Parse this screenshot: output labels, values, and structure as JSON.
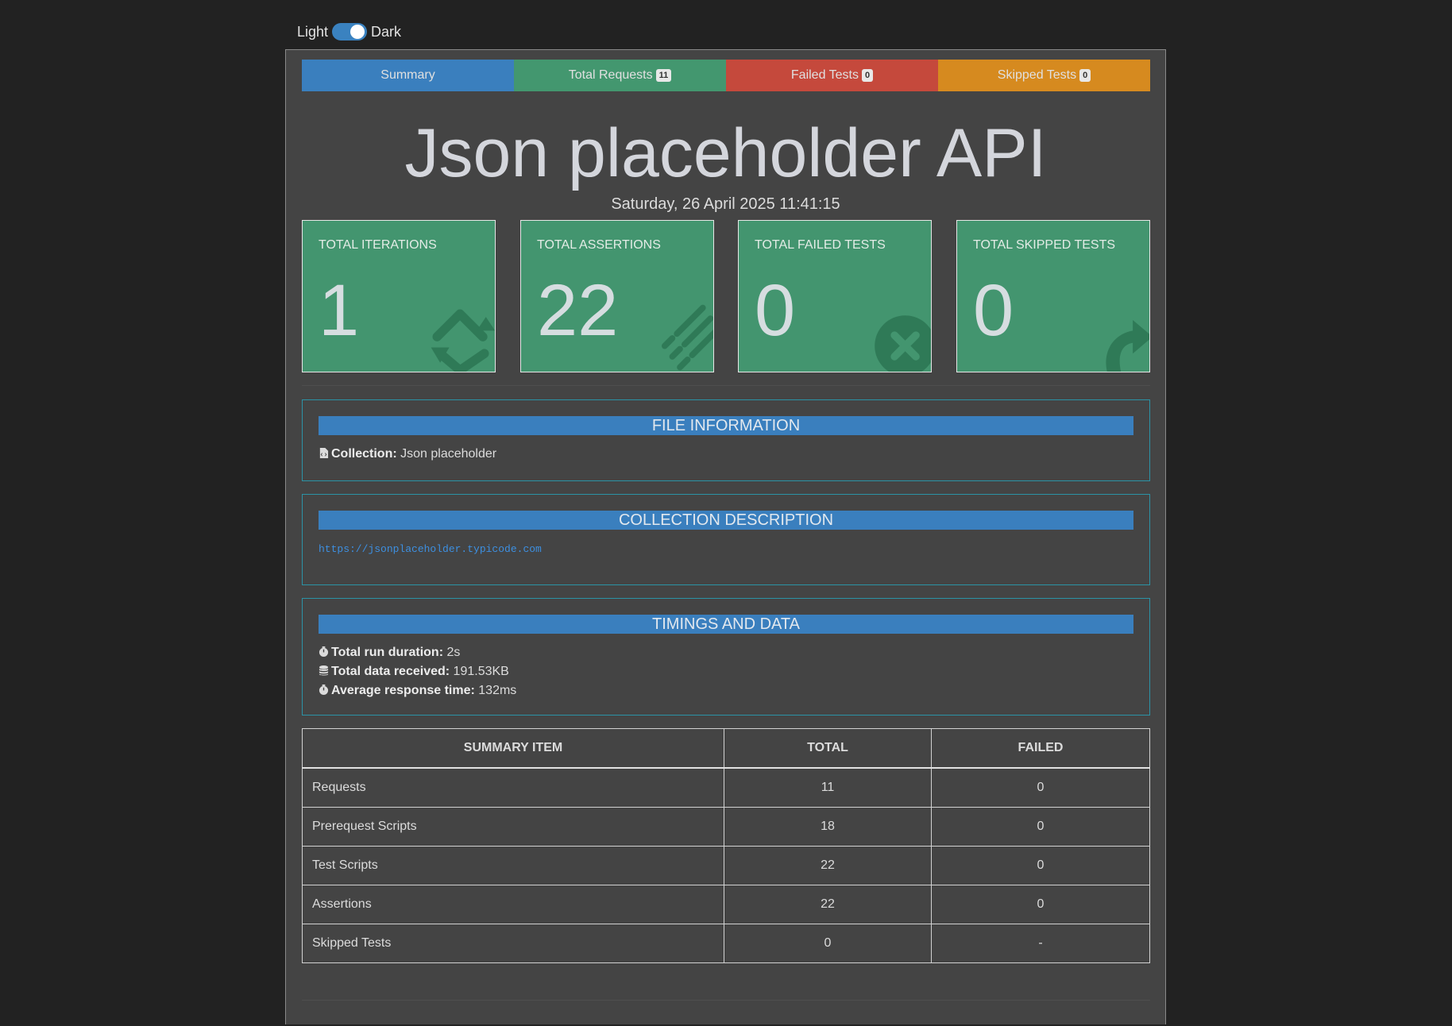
{
  "theme_toggle": {
    "light_label": "Light",
    "dark_label": "Dark"
  },
  "tabs": [
    {
      "label": "Summary"
    },
    {
      "label": "Total Requests",
      "badge": "11"
    },
    {
      "label": "Failed Tests",
      "badge": "0"
    },
    {
      "label": "Skipped Tests",
      "badge": "0"
    }
  ],
  "header": {
    "title": "Json placeholder API",
    "date": "Saturday, 26 April 2025 11:41:15"
  },
  "cards": [
    {
      "label": "TOTAL ITERATIONS",
      "value": "1",
      "icon": "sync-icon"
    },
    {
      "label": "TOTAL ASSERTIONS",
      "value": "22",
      "icon": "list-icon"
    },
    {
      "label": "TOTAL FAILED TESTS",
      "value": "0",
      "icon": "times-circle-icon"
    },
    {
      "label": "TOTAL SKIPPED TESTS",
      "value": "0",
      "icon": "share-arrow-icon"
    }
  ],
  "file_info": {
    "heading": "FILE INFORMATION",
    "collection_label": "Collection:",
    "collection_value": "Json placeholder"
  },
  "collection_description": {
    "heading": "COLLECTION DESCRIPTION",
    "link": "https://jsonplaceholder.typicode.com"
  },
  "timings": {
    "heading": "TIMINGS AND DATA",
    "items": [
      {
        "label": "Total run duration:",
        "value": "2s",
        "icon": "stopwatch-icon"
      },
      {
        "label": "Total data received:",
        "value": "191.53KB",
        "icon": "database-icon"
      },
      {
        "label": "Average response time:",
        "value": "132ms",
        "icon": "stopwatch-icon"
      }
    ]
  },
  "summary_table": {
    "headers": [
      "SUMMARY ITEM",
      "TOTAL",
      "FAILED"
    ],
    "rows": [
      [
        "Requests",
        "11",
        "0"
      ],
      [
        "Prerequest Scripts",
        "18",
        "0"
      ],
      [
        "Test Scripts",
        "22",
        "0"
      ],
      [
        "Assertions",
        "22",
        "0"
      ],
      [
        "Skipped Tests",
        "0",
        "-"
      ]
    ]
  },
  "colors": {
    "page_bg": "#222222",
    "container_bg": "#444444",
    "summary_tab": "#3a7fbe",
    "requests_tab": "#43976f",
    "failed_tab": "#c5493c",
    "skipped_tab": "#d68a1f",
    "card_bg": "#43956f",
    "panel_border": "#2b93a6"
  }
}
